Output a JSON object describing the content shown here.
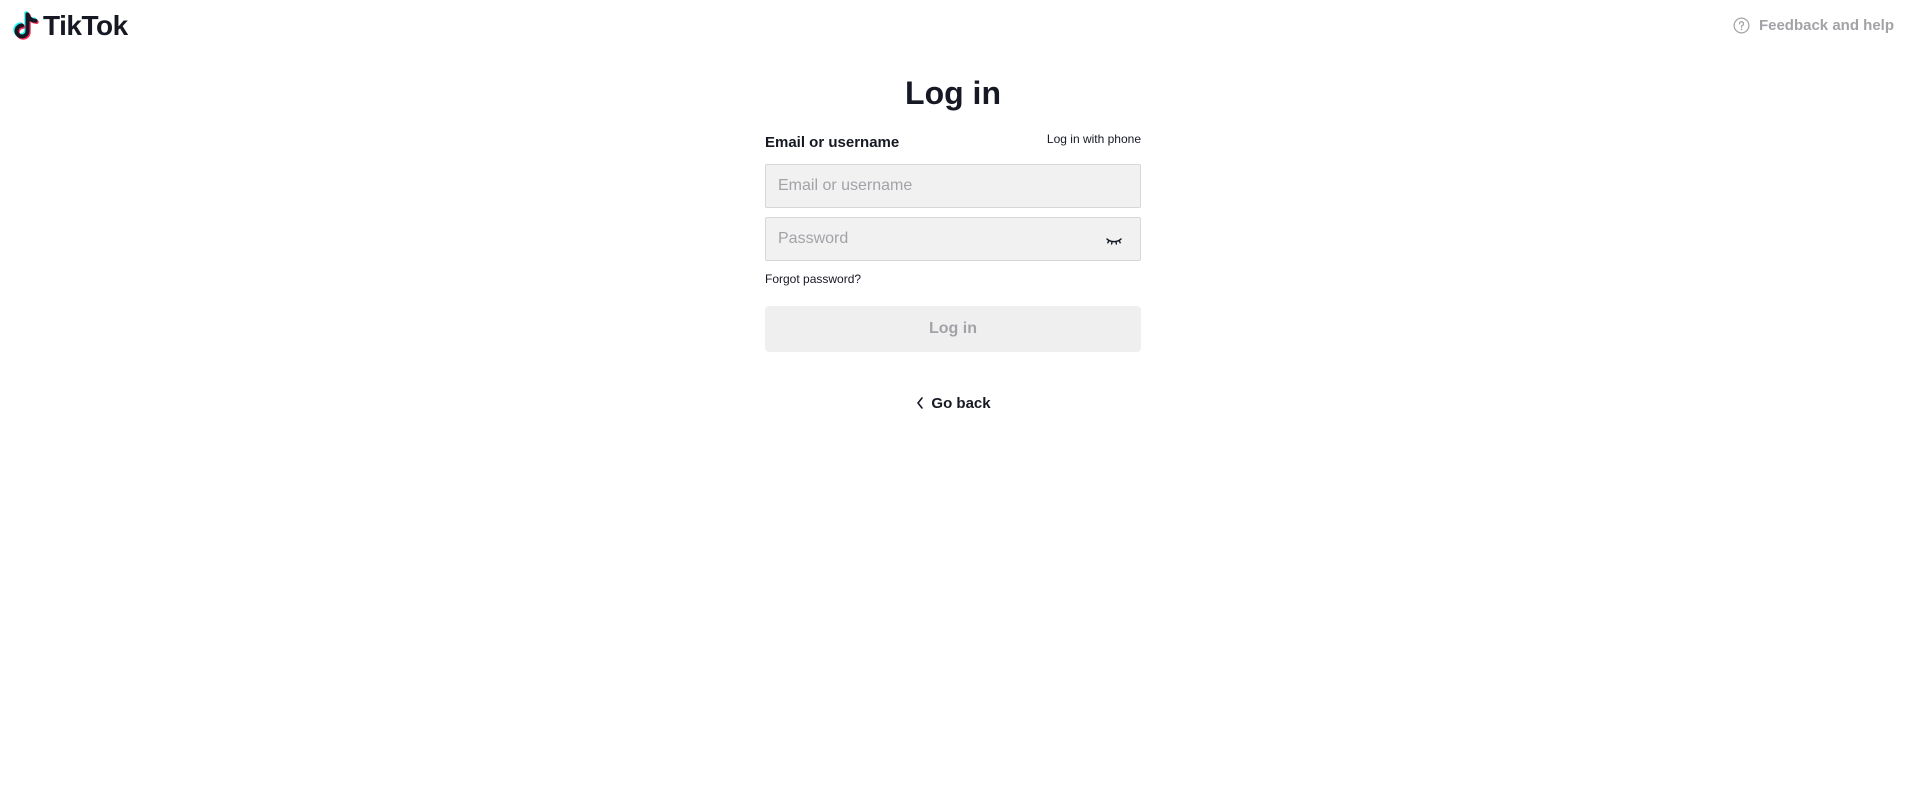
{
  "header": {
    "logo_text": "TikTok",
    "help_label": "Feedback and help"
  },
  "form": {
    "title": "Log in",
    "field_label": "Email or username",
    "phone_link": "Log in with phone",
    "email_placeholder": "Email or username",
    "email_value": "",
    "password_placeholder": "Password",
    "password_value": "",
    "forgot_label": "Forgot password?",
    "login_label": "Log in",
    "go_back_label": "Go back"
  },
  "icons": {
    "logo": "tiktok-note-icon",
    "help": "question-circle-icon",
    "password_toggle": "eye-closed-icon",
    "back": "chevron-left-icon"
  },
  "colors": {
    "text": "#161823",
    "muted": "#a2a3a7",
    "input_bg": "#f1f1f2",
    "button_disabled_bg": "#efeff0",
    "brand_cyan": "#25f4ee",
    "brand_red": "#fe2c55"
  }
}
